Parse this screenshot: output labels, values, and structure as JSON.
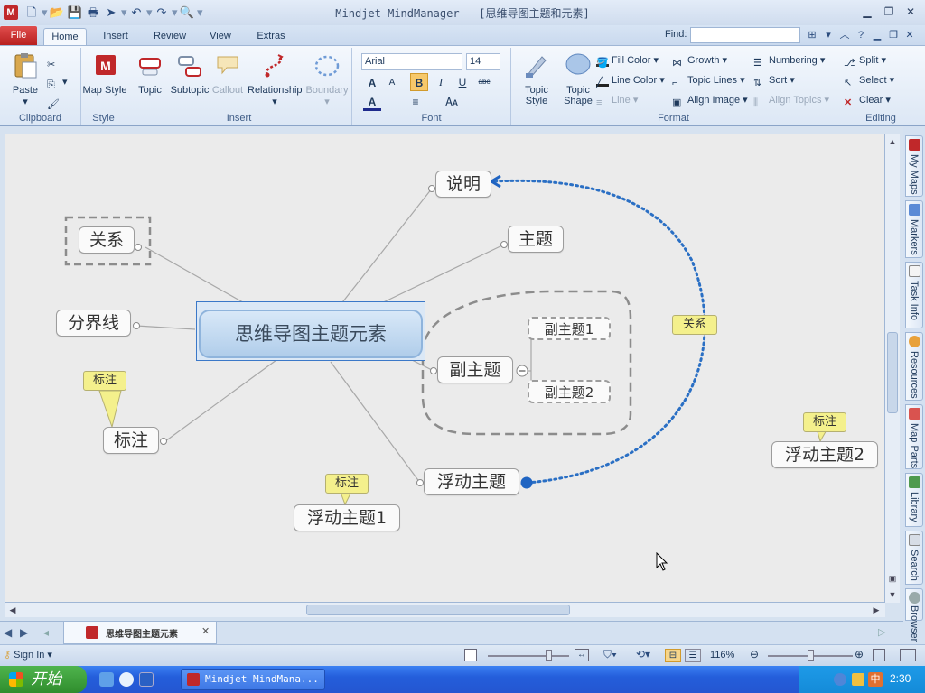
{
  "window": {
    "title": "Mindjet MindManager - [思维导图主题和元素]",
    "app_icon": "M"
  },
  "tabs": {
    "file": "File",
    "items": [
      "Home",
      "Insert",
      "Review",
      "View",
      "Extras"
    ],
    "active": "Home",
    "find_label": "Find:",
    "find_value": ""
  },
  "ribbon": {
    "clipboard": {
      "label": "Clipboard",
      "paste": "Paste"
    },
    "style": {
      "label": "Style",
      "map_style": "Map Style"
    },
    "insert": {
      "label": "Insert",
      "buttons": [
        "Topic",
        "Subtopic",
        "Callout",
        "Relationship",
        "Boundary"
      ]
    },
    "font": {
      "label": "Font",
      "family": "Arial",
      "size": "14",
      "bold": "B",
      "italic": "I",
      "underline": "U",
      "strike": "abc"
    },
    "format": {
      "label": "Format",
      "topic_style": "Topic Style",
      "topic_shape": "Topic Shape",
      "fill_color": "Fill Color",
      "line_color": "Line Color",
      "line": "Line",
      "growth": "Growth",
      "topic_lines": "Topic Lines",
      "align_image": "Align Image",
      "numbering": "Numbering",
      "sort": "Sort",
      "align_topics": "Align Topics"
    },
    "editing": {
      "label": "Editing",
      "split": "Split",
      "select": "Select",
      "clear": "Clear"
    }
  },
  "map": {
    "central": "思维导图主题元素",
    "topics": {
      "shuoming": "说明",
      "zhuti": "主题",
      "guanxi": "关系",
      "fenjiexian": "分界线",
      "biaozhu": "标注",
      "fuzhuti": "副主题",
      "fudong": "浮动主题",
      "fudong1": "浮动主题1",
      "fudong2": "浮动主题2"
    },
    "subtopics": [
      "副主题1",
      "副主题2"
    ],
    "callouts": {
      "c1": "标注",
      "c2": "标注",
      "c3": "标注"
    },
    "relationship_label": "关系"
  },
  "side_panel": [
    "My Maps",
    "Markers",
    "Task Info",
    "Resources",
    "Map Parts",
    "Library",
    "Search",
    "Browser"
  ],
  "document_tab": "思维导图主题元素",
  "status": {
    "sign_in": "Sign In",
    "zoom": "116%"
  },
  "taskbar": {
    "start": "开始",
    "task": "Mindjet MindMana...",
    "ime": "中",
    "time": "2:30"
  }
}
